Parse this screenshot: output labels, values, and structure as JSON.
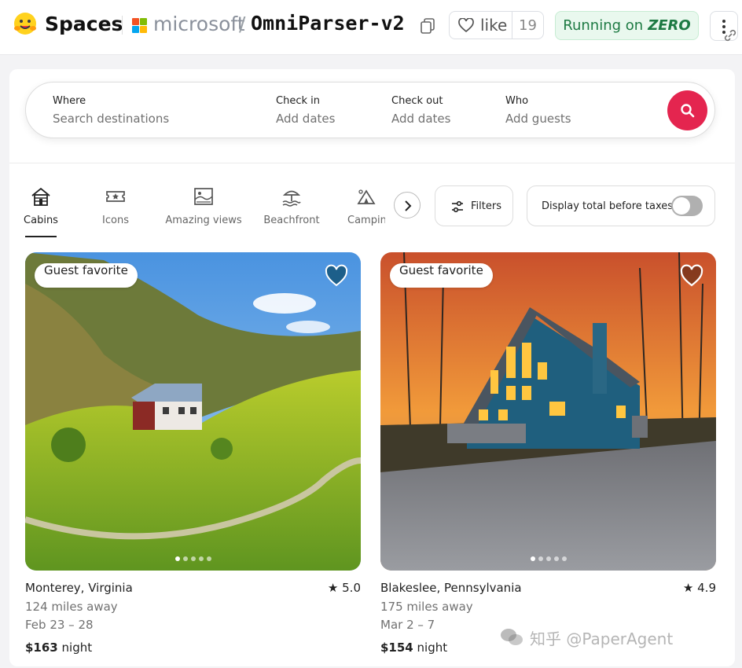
{
  "header": {
    "brand": "Spaces",
    "org": "microsoft",
    "separator": "/",
    "repo": "OmniParser-v2",
    "like_label": "like",
    "like_count": "19",
    "status_prefix": "Running on",
    "status_hardware": "ZERO"
  },
  "search": {
    "where_title": "Where",
    "where_placeholder": "Search destinations",
    "checkin_title": "Check in",
    "checkin_placeholder": "Add dates",
    "checkout_title": "Check out",
    "checkout_placeholder": "Add dates",
    "who_title": "Who",
    "who_placeholder": "Add guests",
    "search_icon": "search-icon"
  },
  "categories": [
    {
      "label": "Cabins",
      "icon": "cabin-icon",
      "active": true
    },
    {
      "label": "Icons",
      "icon": "ticket-icon",
      "active": false
    },
    {
      "label": "Amazing views",
      "icon": "landscape-icon",
      "active": false
    },
    {
      "label": "Beachfront",
      "icon": "beach-icon",
      "active": false
    },
    {
      "label": "Camping",
      "icon": "tent-icon",
      "active": false
    }
  ],
  "filters_label": "Filters",
  "tax_label": "Display total before taxes",
  "tax_toggle_on": false,
  "listings": [
    {
      "badge": "Guest favorite",
      "location": "Monterey, Virginia",
      "rating": "5.0",
      "distance": "124 miles away",
      "dates": "Feb 23 – 28",
      "price": "$163",
      "price_unit": " night",
      "favorited": true
    },
    {
      "badge": "Guest favorite",
      "location": "Blakeslee, Pennsylvania",
      "rating": "4.9",
      "distance": "175 miles away",
      "dates": "Mar 2 – 7",
      "price": "$154",
      "price_unit": " night",
      "favorited": false
    }
  ],
  "watermark": "知乎 @PaperAgent",
  "colors": {
    "accent": "#e4254f",
    "heart_filled": "#1d5f8a",
    "status_bg": "#e9f8ee",
    "status_text": "#1d7a43"
  }
}
